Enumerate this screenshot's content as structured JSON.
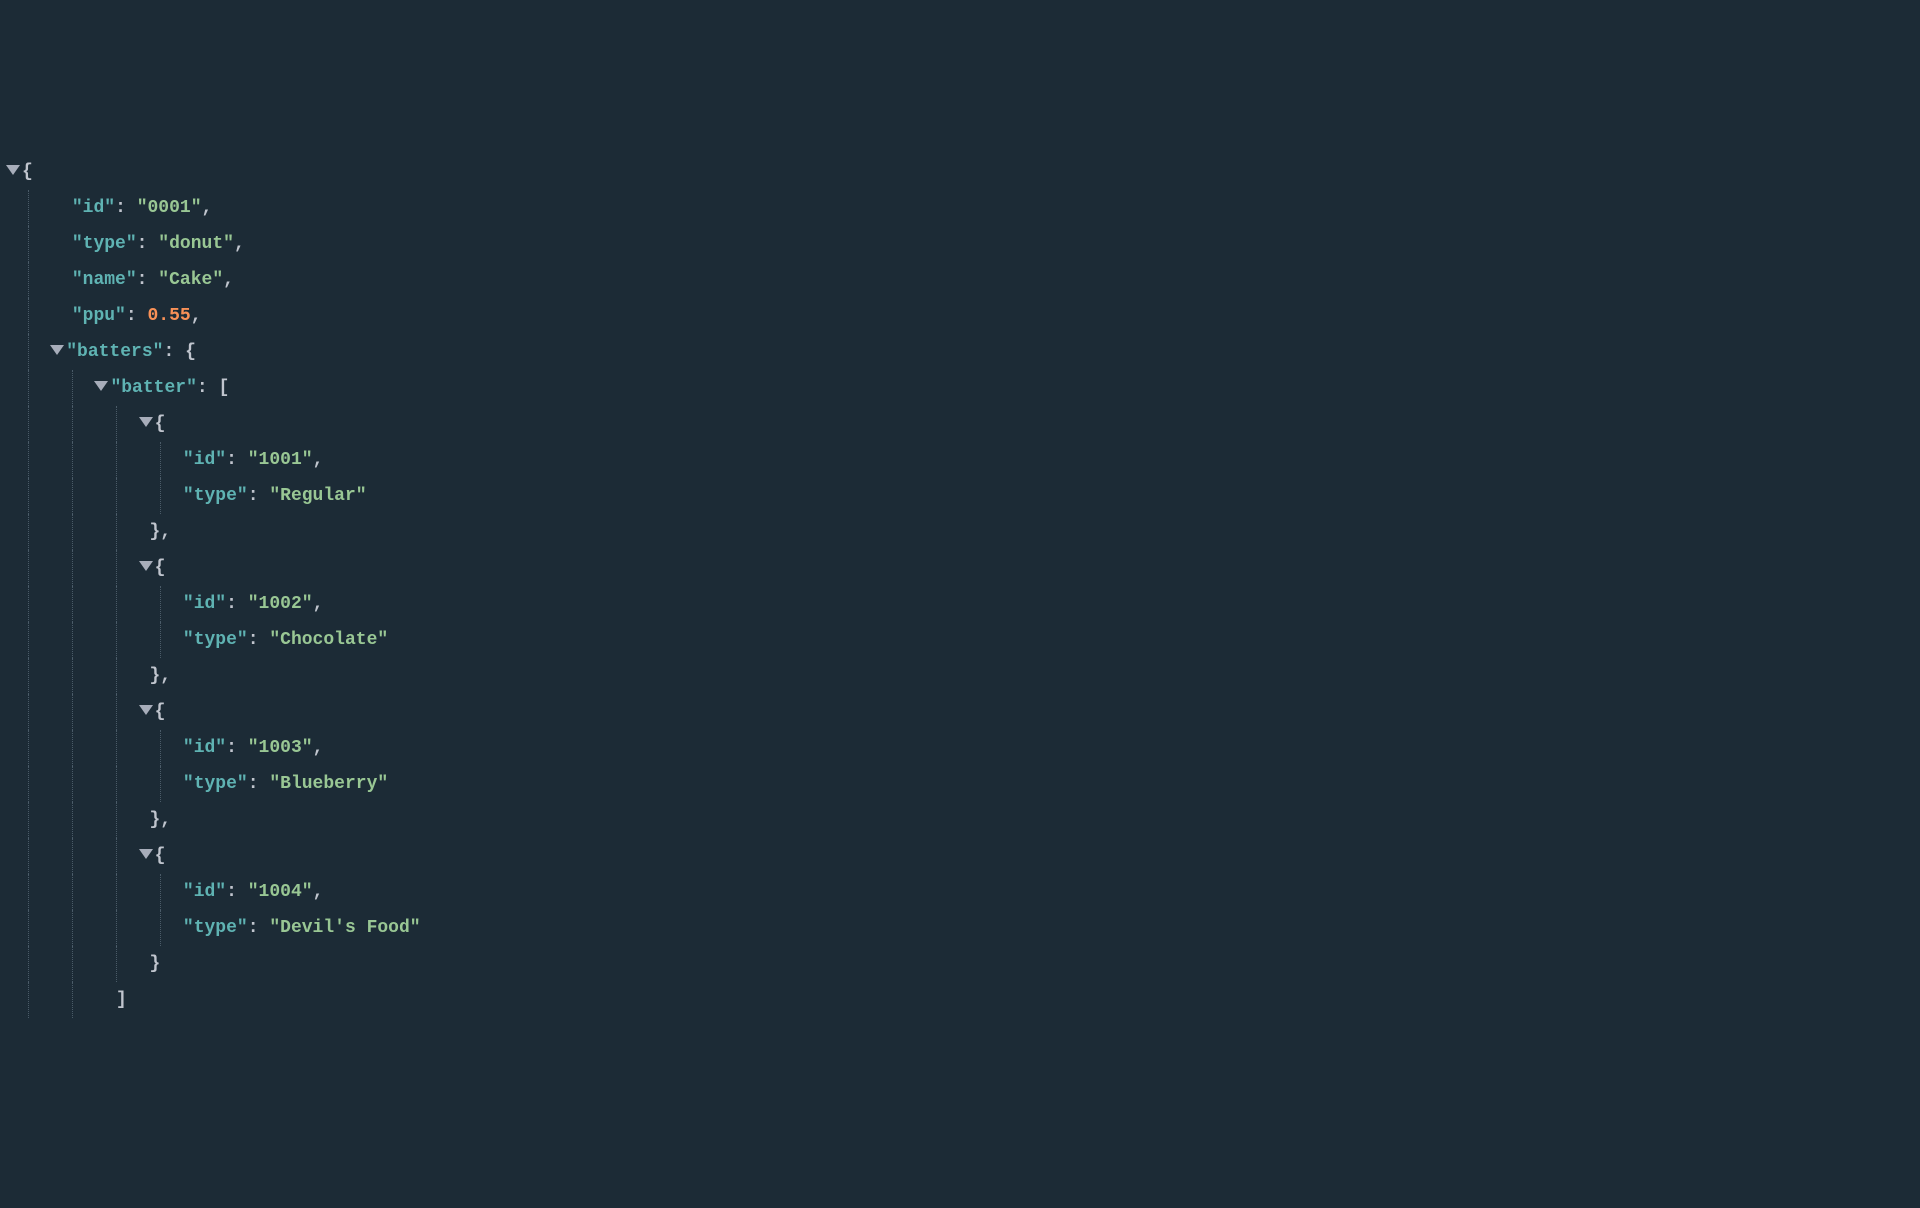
{
  "q": "\"",
  "colon": ":",
  "comma": ",",
  "open_brace": "{",
  "close_brace": "}",
  "open_bracket": "[",
  "close_bracket": "]",
  "root": {
    "id_key": "id",
    "id_val": "0001",
    "type_key": "type",
    "type_val": "donut",
    "name_key": "name",
    "name_val": "Cake",
    "ppu_key": "ppu",
    "ppu_val": "0.55",
    "batters_key": "batters",
    "batter_key": "batter",
    "items": [
      {
        "id_key": "id",
        "id_val": "1001",
        "type_key": "type",
        "type_val": "Regular"
      },
      {
        "id_key": "id",
        "id_val": "1002",
        "type_key": "type",
        "type_val": "Chocolate"
      },
      {
        "id_key": "id",
        "id_val": "1003",
        "type_key": "type",
        "type_val": "Blueberry"
      },
      {
        "id_key": "id",
        "id_val": "1004",
        "type_key": "type",
        "type_val": "Devil's Food"
      }
    ]
  }
}
